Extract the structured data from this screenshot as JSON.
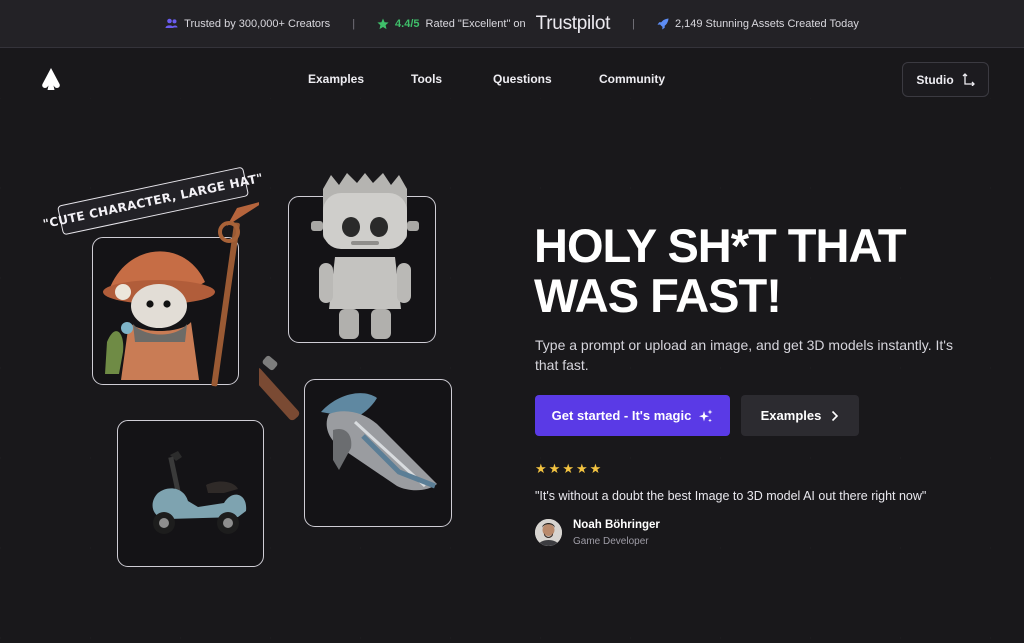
{
  "banner": {
    "creators": "Trusted by 300,000+ Creators",
    "rating_score": "4.4/5",
    "rating_text": "Rated \"Excellent\" on",
    "trustpilot": "Trustpilot",
    "assets": "2,149 Stunning Assets Created Today",
    "separator": "|"
  },
  "nav": {
    "links": [
      "Examples",
      "Tools",
      "Questions",
      "Community"
    ],
    "studio": "Studio"
  },
  "hero": {
    "title_line1": "HOLY SH*T THAT",
    "title_line2": "WAS FAST!",
    "subtitle": "Type a prompt or upload an image, and get 3D models instantly. It's that fast.",
    "cta_primary": "Get started - It's magic",
    "cta_secondary": "Examples",
    "tag": "\"CUTE CHARACTER, LARGE HAT\""
  },
  "testimonial": {
    "rating": 5,
    "quote": "\"It's without a doubt the best Image to 3D model AI out there right now\"",
    "name": "Noah Böhringer",
    "role": "Game Developer"
  },
  "colors": {
    "background": "#19181b",
    "accent": "#5a3ae6",
    "star": "#f3c341",
    "trust_green": "#3fbf6a"
  }
}
